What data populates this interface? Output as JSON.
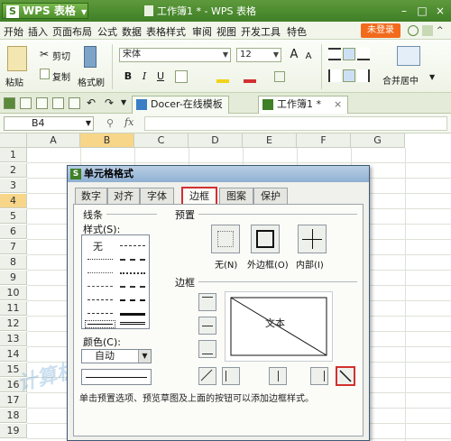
{
  "titlebar": {
    "app_label": "WPS 表格",
    "app_logo": "S",
    "doc_title": "工作簿1 * - WPS 表格",
    "window_controls": [
      "minimize-icon",
      "maximize-icon",
      "close-icon"
    ]
  },
  "menubar": {
    "items": [
      "开始",
      "插入",
      "页面布局",
      "公式",
      "数据",
      "表格样式",
      "审阅",
      "视图",
      "开发工具",
      "特色"
    ],
    "login_label": "未登录"
  },
  "ribbon": {
    "paste_label": "粘贴",
    "cut_label": "剪切",
    "copy_label": "复制",
    "format_painter_label": "格式刷",
    "font_name": "宋体",
    "font_size": "12",
    "bold": "B",
    "italic": "I",
    "underline": "U",
    "font_grow": "A",
    "font_shrink": "A",
    "merge_label": "合并居中"
  },
  "qat": {
    "tabs": [
      {
        "label": "Docer-在线模板",
        "icon": "docer-icon"
      },
      {
        "label": "工作簿1 *",
        "icon": "sheet-icon"
      }
    ]
  },
  "formulabar": {
    "cell_ref": "B4",
    "fx": "fx"
  },
  "grid": {
    "columns": [
      "A",
      "B",
      "C",
      "D",
      "E",
      "F",
      "G"
    ],
    "rows": [
      "1",
      "2",
      "3",
      "4",
      "5",
      "6",
      "7",
      "8",
      "9",
      "10",
      "11",
      "12",
      "13",
      "14",
      "15",
      "16",
      "17",
      "18",
      "19"
    ],
    "active_col": "B",
    "active_row": "4"
  },
  "dialog": {
    "title": "单元格格式",
    "tabs": [
      "数字",
      "对齐",
      "字体",
      "边框",
      "图案",
      "保护"
    ],
    "active_tab": "边框",
    "line_group": "线条",
    "style_label": "样式(S):",
    "style_none": "无",
    "color_label": "颜色(C):",
    "color_value": "自动",
    "presets_group": "预置",
    "presets": [
      "无(N)",
      "外边框(O)",
      "内部(I)"
    ],
    "border_group": "边框",
    "preview_text": "文本",
    "hint": "单击预置选项、预览草图及上面的按钮可以添加边框样式。"
  },
  "watermark": [
    "计算机入门",
    "www.pcxsb.com"
  ]
}
